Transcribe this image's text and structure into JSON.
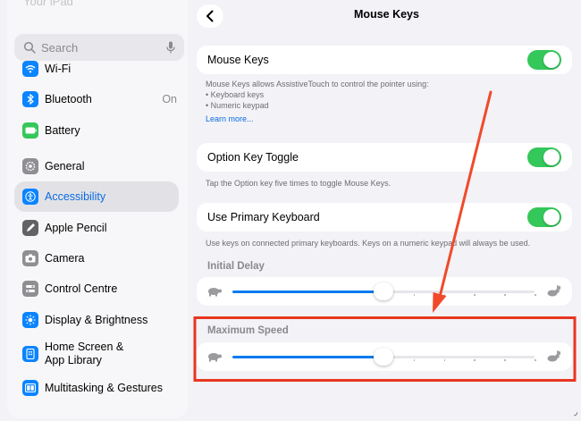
{
  "sidebar": {
    "top_partial_label": "Your iPad",
    "search_placeholder": "Search",
    "items": [
      {
        "label": "Wi-Fi",
        "icon": "wifi-icon",
        "color": "#0a84ff"
      },
      {
        "label": "Bluetooth",
        "icon": "bluetooth-icon",
        "color": "#0a84ff",
        "value": "On"
      },
      {
        "label": "Battery",
        "icon": "battery-icon",
        "color": "#34c759"
      },
      {
        "label": "General",
        "icon": "gear-icon",
        "color": "#8e8e93"
      },
      {
        "label": "Accessibility",
        "icon": "accessibility-icon",
        "color": "#0a84ff",
        "selected": true
      },
      {
        "label": "Apple Pencil",
        "icon": "pencil-icon",
        "color": "#636366"
      },
      {
        "label": "Camera",
        "icon": "camera-icon",
        "color": "#8e8e93"
      },
      {
        "label": "Control Centre",
        "icon": "control-centre-icon",
        "color": "#8e8e93"
      },
      {
        "label": "Display & Brightness",
        "icon": "sun-icon",
        "color": "#0a84ff"
      },
      {
        "label": "Home Screen &\nApp Library",
        "icon": "home-screen-icon",
        "color": "#0a84ff"
      },
      {
        "label": "Multitasking & Gestures",
        "icon": "multitasking-icon",
        "color": "#0a84ff"
      }
    ]
  },
  "header": {
    "title": "Mouse Keys",
    "back_icon": "chevron-left-icon"
  },
  "mouse_keys": {
    "label": "Mouse Keys",
    "enabled": true,
    "description_line1": "Mouse Keys allows AssistiveTouch to control the pointer using:",
    "description_line2": "•  Keyboard keys",
    "description_line3": "•  Numeric keypad",
    "learn_more": "Learn more..."
  },
  "option_key_toggle": {
    "label": "Option Key Toggle",
    "enabled": true,
    "footnote": "Tap the Option key five times to toggle Mouse Keys."
  },
  "use_primary_keyboard": {
    "label": "Use Primary Keyboard",
    "enabled": true,
    "footnote": "Use keys on connected primary keyboards. Keys on a numeric keypad will always be used."
  },
  "initial_delay": {
    "header": "Initial Delay",
    "value_fraction": 0.5,
    "min_icon": "turtle-icon",
    "max_icon": "rabbit-icon"
  },
  "maximum_speed": {
    "header": "Maximum Speed",
    "value_fraction": 0.5,
    "min_icon": "turtle-icon",
    "max_icon": "rabbit-icon"
  },
  "colors": {
    "accent": "#0b7bef",
    "toggle_on": "#34c759",
    "highlight_box": "#e8361f",
    "arrow": "#f04a2a"
  }
}
